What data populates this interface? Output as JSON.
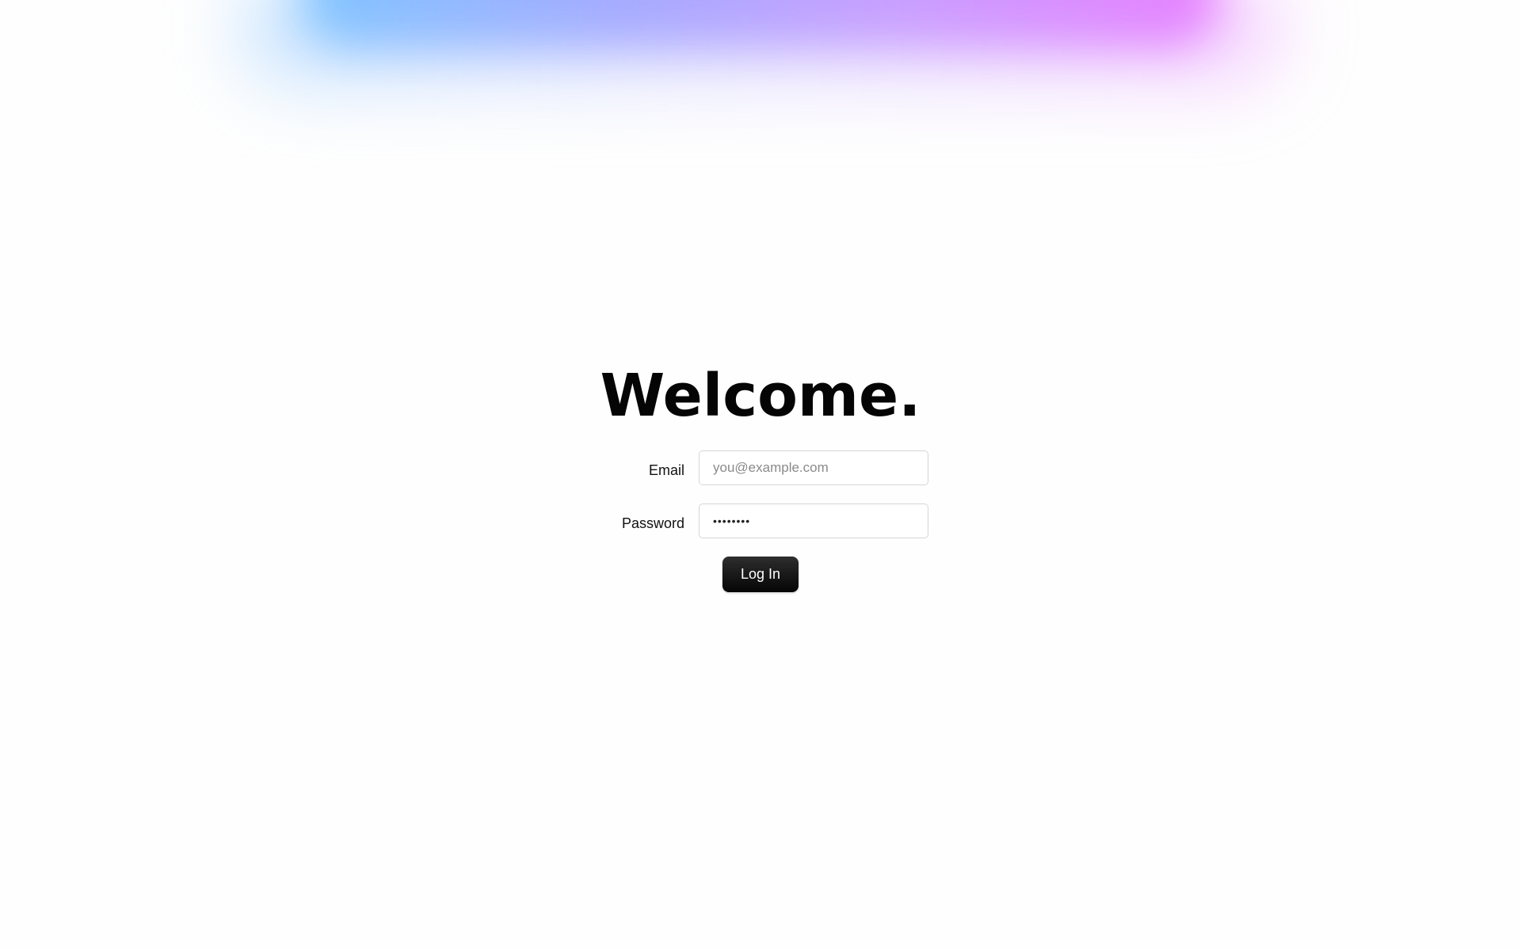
{
  "login": {
    "title": "Welcome.",
    "email_label": "Email",
    "email_placeholder": "you@example.com",
    "email_value": "",
    "password_label": "Password",
    "password_value": "password",
    "login_button": "Log In"
  },
  "colors": {
    "background": "#fefefe",
    "button": "#111111",
    "gradient": [
      "#7cc4ff",
      "#a3a8ff",
      "#c79cff",
      "#e77cff"
    ]
  }
}
